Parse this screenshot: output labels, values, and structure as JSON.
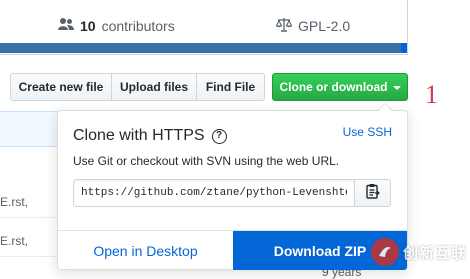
{
  "summary": {
    "contributors_count": "10",
    "contributors_label": "contributors",
    "license": "GPL-2.0"
  },
  "toolbar": {
    "create_new_file": "Create new file",
    "upload_files": "Upload files",
    "find_file": "Find File",
    "clone_or_download": "Clone or download"
  },
  "annotation": "1",
  "file_list": {
    "rows": [
      {
        "text": "E.rst,"
      },
      {
        "text": "E.rst,"
      }
    ],
    "age_text": "9 years"
  },
  "clone_dropdown": {
    "title": "Clone with HTTPS",
    "help_icon": "?",
    "use_ssh": "Use SSH",
    "description": "Use Git or checkout with SVN using the web URL.",
    "url": "https://github.com/ztane/python-Levenshtein.git",
    "open_in_desktop": "Open in Desktop",
    "download_zip": "Download ZIP"
  },
  "watermark": {
    "text": "创新互联"
  },
  "colors": {
    "clone_green": "#28a745",
    "link_blue": "#0366d6",
    "download_blue": "#0366d6",
    "annotation_red": "#d73a49"
  }
}
